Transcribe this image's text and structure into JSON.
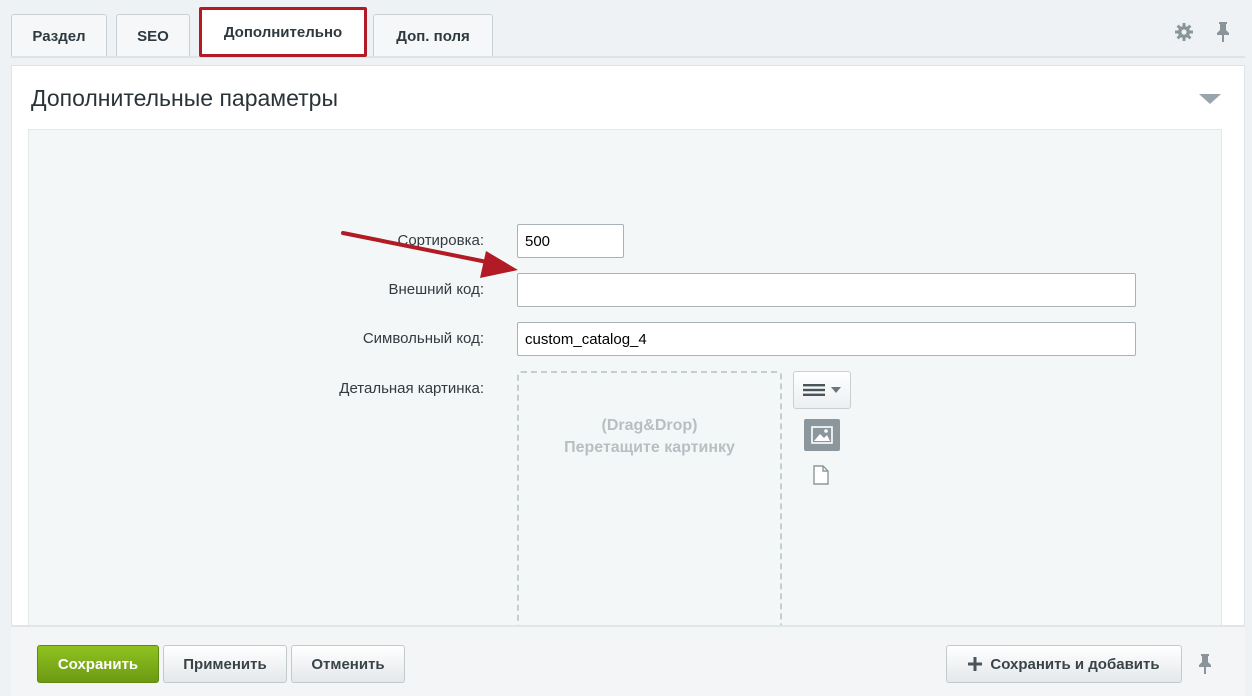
{
  "tabs": [
    {
      "label": "Раздел"
    },
    {
      "label": "SEO"
    },
    {
      "label": "Дополнительно"
    },
    {
      "label": "Доп. поля"
    }
  ],
  "header_icons": [
    "gear-icon",
    "pin-icon"
  ],
  "section": {
    "title": "Дополнительные параметры"
  },
  "form": {
    "sort_label": "Сортировка:",
    "sort_value": "500",
    "external_code_label": "Внешний код:",
    "external_code_value": "",
    "symbol_code_label": "Символьный код:",
    "symbol_code_value": "custom_catalog_4",
    "detail_image_label": "Детальная картинка:",
    "dropzone_line1": "(Drag&Drop)",
    "dropzone_line2": "Перетащите картинку"
  },
  "buttons": {
    "save": "Сохранить",
    "apply": "Применить",
    "cancel": "Отменить",
    "save_and_add": "Сохранить и добавить"
  },
  "colors": {
    "active_tab_highlight": "#b21b25",
    "annotation_arrow": "#b21b25",
    "save_button": "#7fb11a"
  }
}
